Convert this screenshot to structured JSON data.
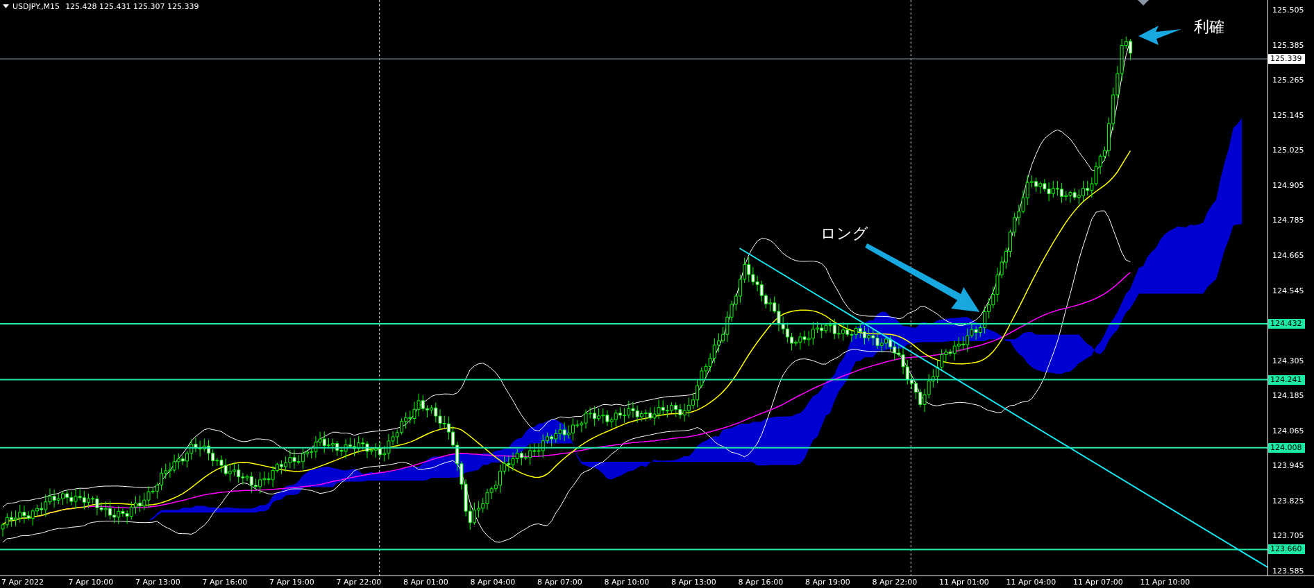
{
  "header": {
    "symbol": "USDJPY.,M15",
    "ohlc": "125.428 125.431 125.307 125.339"
  },
  "price_axis": [
    "125.505",
    "125.385",
    "125.265",
    "125.145",
    "125.025",
    "124.905",
    "124.785",
    "124.665",
    "124.545",
    "124.305",
    "124.185",
    "124.065",
    "123.945",
    "123.825",
    "123.705",
    "123.585"
  ],
  "current_price": "125.339",
  "levels": [
    {
      "price": "124.432"
    },
    {
      "price": "124.241"
    },
    {
      "price": "124.008"
    },
    {
      "price": "123.660"
    }
  ],
  "time_axis": [
    "7 Apr 2022",
    "7 Apr 10:00",
    "7 Apr 13:00",
    "7 Apr 16:00",
    "7 Apr 19:00",
    "7 Apr 22:00",
    "8 Apr 01:00",
    "8 Apr 04:00",
    "8 Apr 07:00",
    "8 Apr 10:00",
    "8 Apr 13:00",
    "8 Apr 16:00",
    "8 Apr 19:00",
    "8 Apr 22:00",
    "11 Apr 01:00",
    "11 Apr 04:00",
    "11 Apr 07:00",
    "11 Apr 10:00"
  ],
  "annotations": [
    {
      "text": "ロング"
    },
    {
      "text": "利確"
    }
  ]
}
